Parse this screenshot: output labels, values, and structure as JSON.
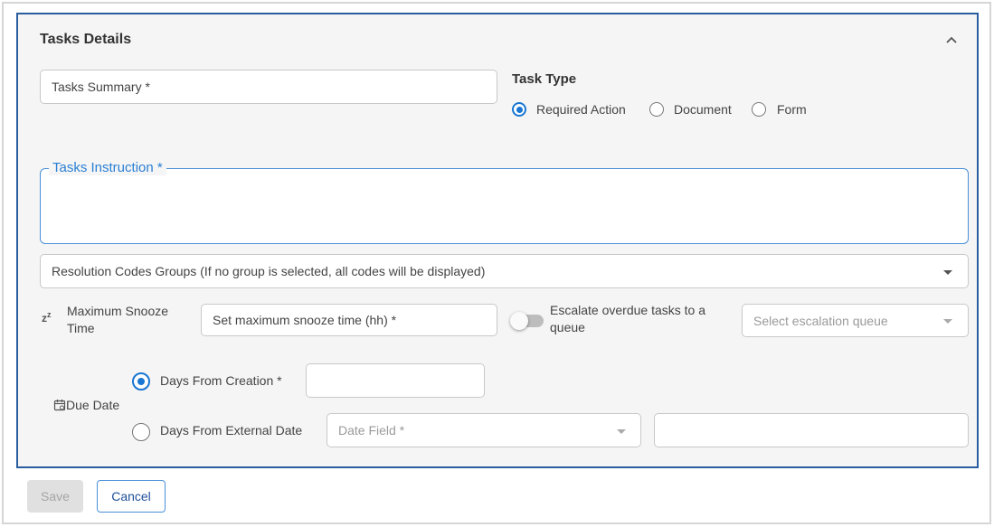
{
  "panel": {
    "title": "Tasks Details"
  },
  "tasks_summary": {
    "placeholder": "Tasks Summary *"
  },
  "task_type": {
    "title": "Task Type",
    "options": [
      {
        "label": "Required Action",
        "checked": true
      },
      {
        "label": "Document",
        "checked": false
      },
      {
        "label": "Form",
        "checked": false
      }
    ]
  },
  "tasks_instruction": {
    "label": "Tasks Instruction *"
  },
  "resolution_codes": {
    "placeholder": "Resolution Codes Groups (If no group is selected, all codes will be displayed)"
  },
  "snooze": {
    "icon": "snooze-icon",
    "label_line1": "Maximum Snooze",
    "label_line2": "Time",
    "placeholder": "Set maximum snooze time (hh) *"
  },
  "escalate": {
    "label_line1": "Escalate overdue tasks to a",
    "label_line2": "queue",
    "enabled": false,
    "queue_placeholder": "Select escalation queue"
  },
  "due_date": {
    "icon": "calendar-icon",
    "label": "Due Date",
    "options": [
      {
        "label": "Days From Creation *",
        "checked": true
      },
      {
        "label": "Days From External Date",
        "checked": false
      }
    ],
    "date_field_placeholder": "Date Field *"
  },
  "footer": {
    "save_label": "Save",
    "cancel_label": "Cancel"
  },
  "colors": {
    "accent": "#1976d2",
    "panel_border": "#2a5d9f",
    "legend": "#2a7fd4"
  }
}
